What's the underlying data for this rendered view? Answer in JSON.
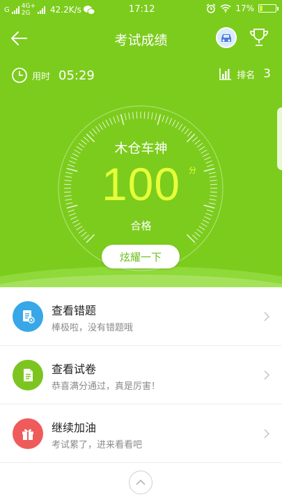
{
  "status_bar": {
    "carrier": "G",
    "network_top": "4G+",
    "network_bottom": "2G",
    "speed": "42.2K/s",
    "time": "17:12",
    "battery": "17%",
    "battery_level": 0.17
  },
  "header": {
    "title": "考试成绩"
  },
  "stats": {
    "time_label": "用时",
    "time_value": "05:29",
    "rank_label": "排名",
    "rank_value": "3"
  },
  "gauge": {
    "title": "木仓车神",
    "score": "100",
    "unit": "分",
    "result": "合格",
    "share_label": "炫耀一下"
  },
  "list": {
    "items": [
      {
        "title": "查看错题",
        "subtitle": "棒极啦，没有错题哦",
        "icon": "wrong-questions-icon",
        "color": "#38a7e8"
      },
      {
        "title": "查看试卷",
        "subtitle": "恭喜满分通过，真是厉害！",
        "icon": "exam-paper-icon",
        "color": "#7cc521"
      },
      {
        "title": "继续加油",
        "subtitle": "考试累了，进来看看吧",
        "icon": "gift-icon",
        "color": "#ef5b5b"
      }
    ]
  },
  "colors": {
    "hero_green": "#7ccc1d",
    "score_yellow": "#e6ff3a"
  }
}
